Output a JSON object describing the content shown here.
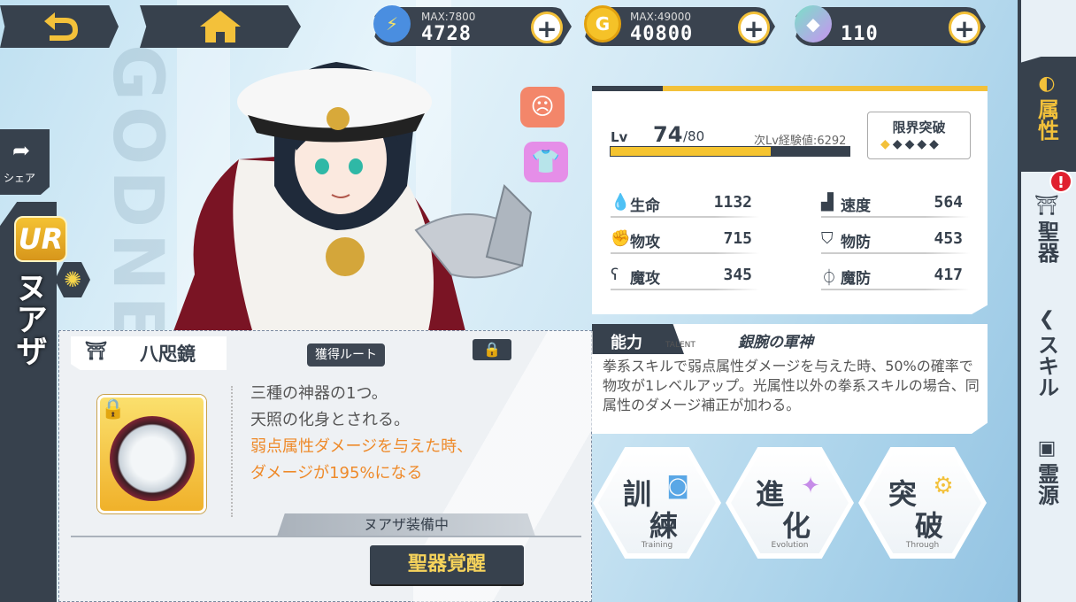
{
  "top_bar": {
    "stamina": {
      "max_label": "MAX:",
      "max": "7800",
      "value": "4728",
      "icon": "stamina-battery-icon"
    },
    "gold": {
      "max_label": "MAX:",
      "max": "49000",
      "value": "40800",
      "icon": "gold-coin-icon"
    },
    "gems": {
      "value": "110",
      "icon": "crystal-icon"
    },
    "plus": "+"
  },
  "left": {
    "share_label": "シェア",
    "rarity": "UR",
    "character_name": "ヌアザ"
  },
  "watermark": "GODNE",
  "stats": {
    "lv_label": "Lv",
    "level": "74",
    "level_max": "/80",
    "next_exp": "次Lv経験値:6292",
    "exp_progress": 0.67,
    "limit_break_title": "限界突破",
    "limit_break_level": 1,
    "limit_break_total": 5,
    "rows": [
      {
        "name": "生命",
        "value": "1132",
        "icon": "hp-drop-icon"
      },
      {
        "name": "速度",
        "value": "564",
        "icon": "speed-boot-icon"
      },
      {
        "name": "物攻",
        "value": "715",
        "icon": "phys-attack-icon"
      },
      {
        "name": "物防",
        "value": "453",
        "icon": "phys-defense-icon"
      },
      {
        "name": "魔攻",
        "value": "345",
        "icon": "magic-attack-icon"
      },
      {
        "name": "魔防",
        "value": "417",
        "icon": "magic-defense-icon"
      }
    ]
  },
  "ability": {
    "label": "能力",
    "talent": "TALENT",
    "name": "銀腕の軍神",
    "description": "拳系スキルで弱点属性ダメージを与えた時、50%の確率で物攻が1レベルアップ。光属性以外の拳系スキルの場合、同属性のダメージ補正が加わる。"
  },
  "actions": [
    {
      "k1": "訓",
      "k2": "練",
      "en": "Training"
    },
    {
      "k1": "進",
      "k2": "化",
      "en": "Evolution"
    },
    {
      "k1": "突",
      "k2": "破",
      "en": "Through"
    }
  ],
  "sidebar": {
    "tabs": [
      {
        "label": "属性",
        "icon": "attribute-icon"
      },
      {
        "label": "聖器",
        "icon": "relic-icon"
      },
      {
        "label": "スキル",
        "icon": "skill-icon"
      },
      {
        "label": "霊源",
        "icon": "spirit-source-icon"
      }
    ],
    "alert": "!"
  },
  "relic_popup": {
    "title": "八咫鏡",
    "route_button": "獲得ルート",
    "desc_lines": [
      "三種の神器の1つ。",
      "天照の化身とされる。"
    ],
    "effect_lines": [
      "弱点属性ダメージを与えた時、",
      "ダメージが195%になる"
    ],
    "equipped_label": "ヌアザ装備中",
    "awaken_button": "聖器覚醒"
  },
  "colors": {
    "accent": "#f3c13a",
    "dark": "#37414d",
    "effect": "#ee8a2a",
    "alert": "#e0202e"
  }
}
